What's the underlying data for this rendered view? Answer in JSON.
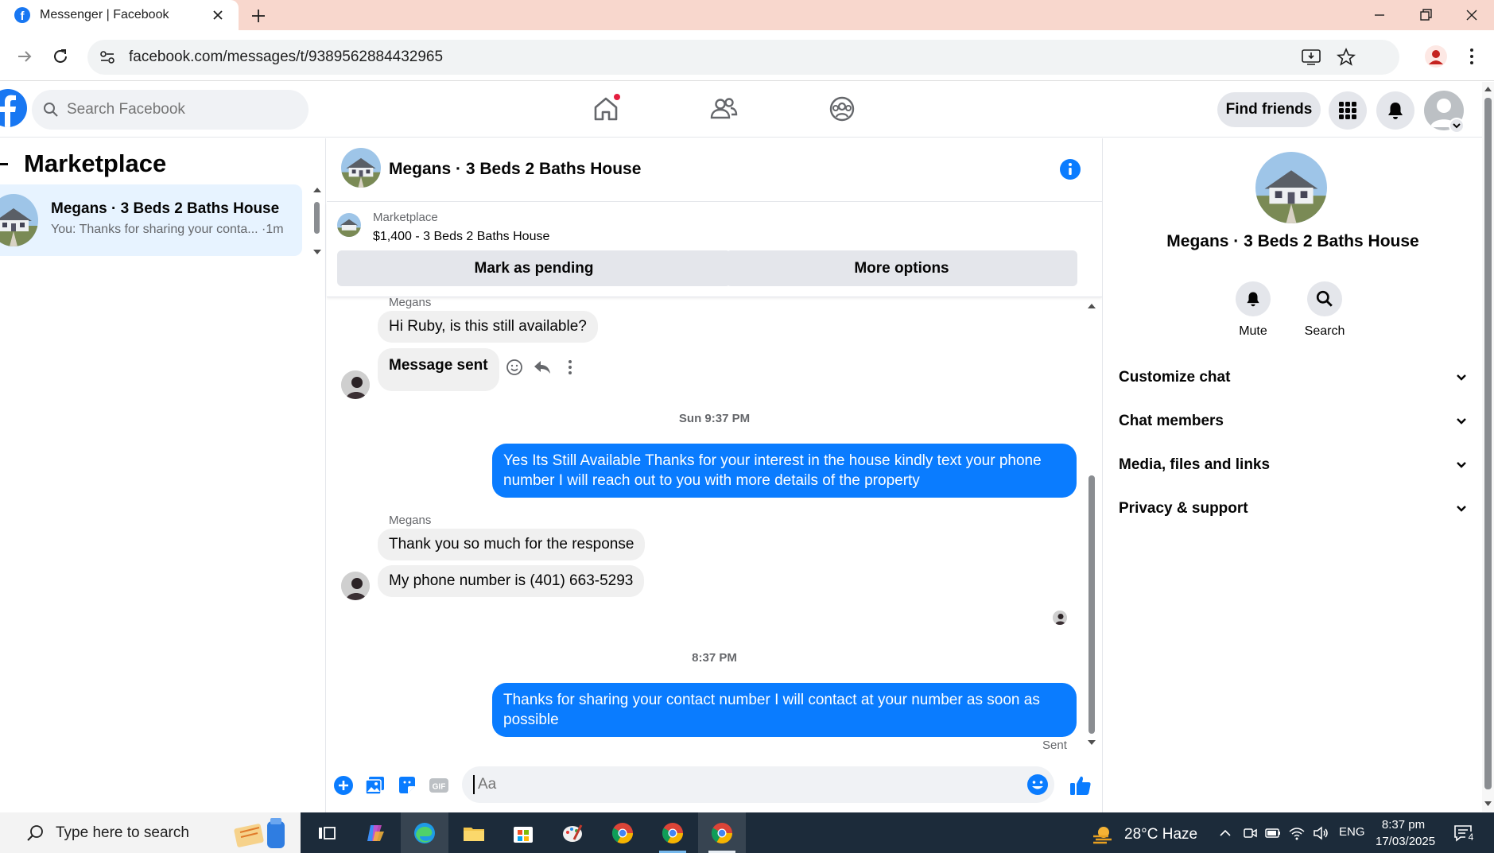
{
  "browser": {
    "tab_title": "Messenger | Facebook",
    "url": "facebook.com/messages/t/9389562884432965"
  },
  "fb_nav": {
    "search_placeholder": "Search Facebook",
    "find_friends": "Find friends"
  },
  "left_panel": {
    "header": "Marketplace",
    "conversation": {
      "name": "Megans · 3 Beds 2 Baths House",
      "preview": "You: Thanks for sharing your conta... ·1m"
    }
  },
  "chat": {
    "title": "Megans · 3 Beds 2 Baths House",
    "listing_label": "Marketplace",
    "listing_price": "$1,400 - 3 Beds 2 Baths House",
    "mark_pending": "Mark as pending",
    "more_options": "More options",
    "messages": [
      {
        "sender": "Megans",
        "text": "Hi Ruby, is this still available?"
      },
      {
        "text": "Message sent"
      },
      {
        "timestamp": "Sun 9:37 PM"
      },
      {
        "text": "Yes Its Still Available Thanks for your interest in the house kindly text your phone number I will reach out to you with more details of the property"
      },
      {
        "sender": "Megans",
        "text": "Thank you so much for the response"
      },
      {
        "text": "My phone number is (401) 663-5293"
      },
      {
        "timestamp": "8:37 PM"
      },
      {
        "text": "Thanks for sharing your contact number I will contact at your number as soon as possible"
      }
    ],
    "sent_status": "Sent",
    "composer_placeholder": "Aa"
  },
  "info_panel": {
    "name": "Megans · 3 Beds 2 Baths House",
    "mute": "Mute",
    "search": "Search",
    "rows": [
      "Customize chat",
      "Chat members",
      "Media, files and links",
      "Privacy & support"
    ]
  },
  "taskbar": {
    "search_placeholder": "Type here to search",
    "weather": "28°C  Haze",
    "language": "ENG",
    "time": "8:37 pm",
    "date": "17/03/2025",
    "notifications": "4"
  },
  "colors": {
    "accent": "#0a7cff",
    "fb_blue": "#1877f2",
    "bubble_in": "#f0f0f0"
  }
}
